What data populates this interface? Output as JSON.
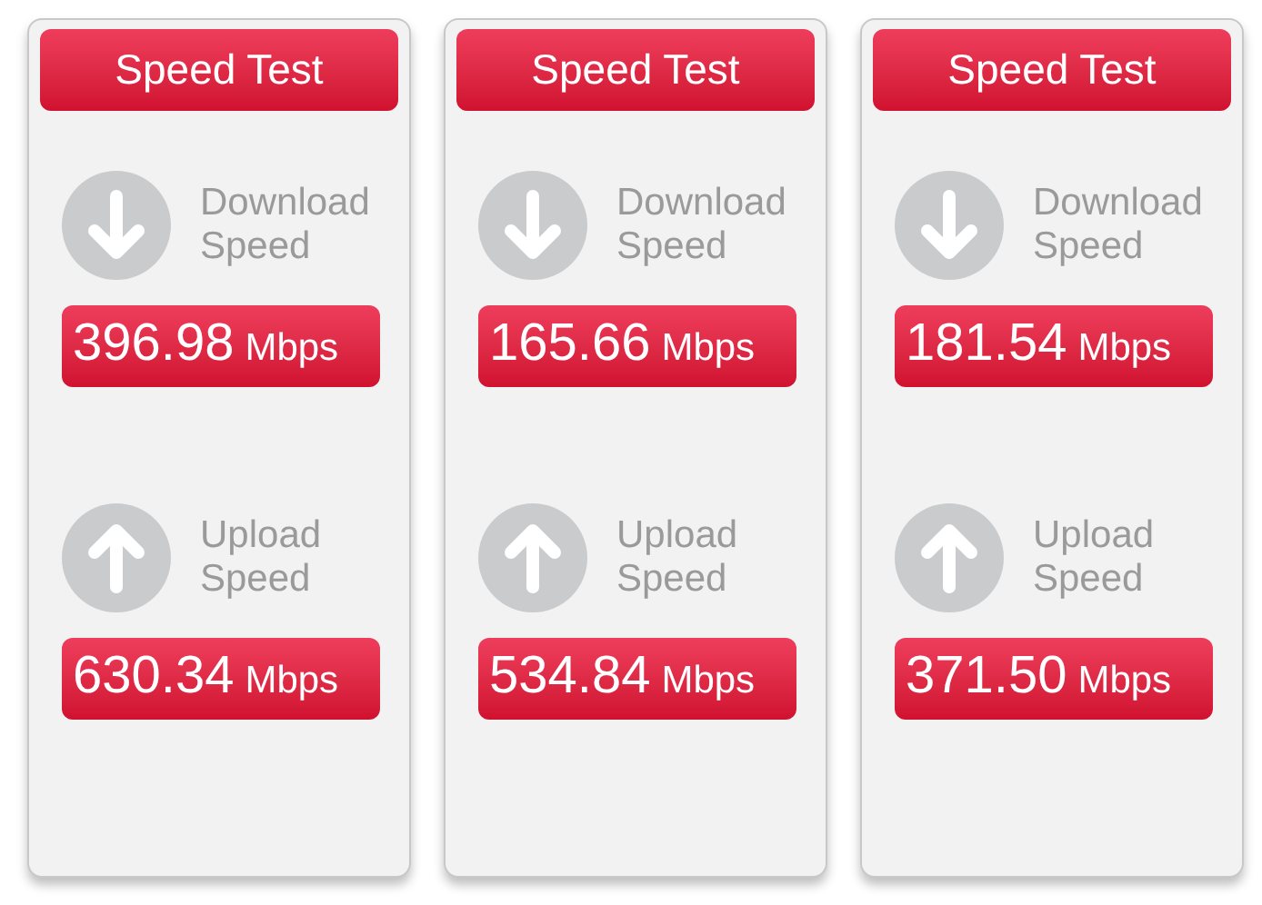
{
  "panels": [
    {
      "title": "Speed Test",
      "metrics": [
        {
          "kind": "download",
          "label": "Download Speed",
          "value": "396.98",
          "unit": "Mbps"
        },
        {
          "kind": "upload",
          "label": "Upload Speed",
          "value": "630.34",
          "unit": "Mbps"
        }
      ]
    },
    {
      "title": "Speed Test",
      "metrics": [
        {
          "kind": "download",
          "label": "Download Speed",
          "value": "165.66",
          "unit": "Mbps"
        },
        {
          "kind": "upload",
          "label": "Upload Speed",
          "value": "534.84",
          "unit": "Mbps"
        }
      ]
    },
    {
      "title": "Speed Test",
      "metrics": [
        {
          "kind": "download",
          "label": "Download Speed",
          "value": "181.54",
          "unit": "Mbps"
        },
        {
          "kind": "upload",
          "label": "Upload Speed",
          "value": "371.50",
          "unit": "Mbps"
        }
      ]
    }
  ]
}
